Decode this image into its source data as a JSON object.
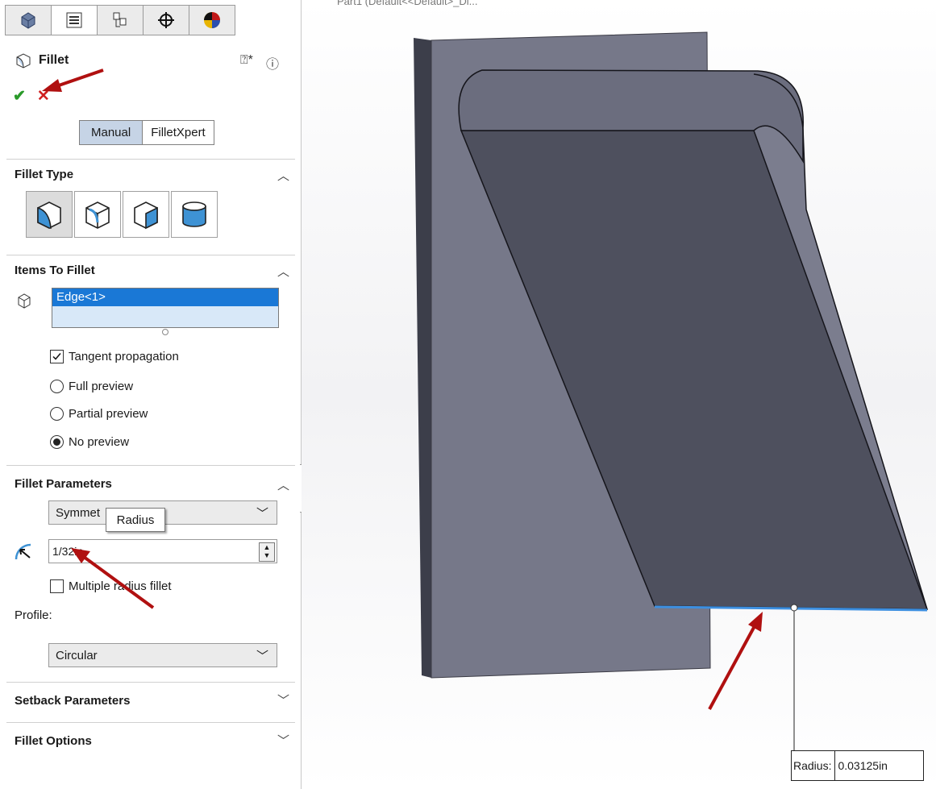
{
  "viewport": {
    "title": "Part1 (Default<<Default>_Di..."
  },
  "property_manager": {
    "tabs": [
      "feature-manager-icon",
      "property-manager-icon",
      "configuration-manager-icon",
      "dimxpert-manager-icon",
      "display-manager-icon"
    ],
    "active_tab": 1,
    "title": "Fillet",
    "mode_buttons": {
      "manual": "Manual",
      "filletxpert": "FilletXpert"
    },
    "fillet_type": {
      "heading": "Fillet Type",
      "options": [
        "constant-size-fillet-icon",
        "variable-size-fillet-icon",
        "face-fillet-icon",
        "full-round-fillet-icon"
      ],
      "selected": 0
    },
    "items_to_fillet": {
      "heading": "Items To Fillet",
      "selection": "Edge<1>",
      "tangent_propagation": {
        "label": "Tangent propagation",
        "checked": true
      },
      "preview_options": [
        "Full preview",
        "Partial preview",
        "No preview"
      ],
      "preview_selected": "No preview"
    },
    "fillet_parameters": {
      "heading": "Fillet Parameters",
      "method": "Symmet",
      "tooltip": "Radius",
      "radius": "1/32in",
      "multiple_radius": {
        "label": "Multiple radius fillet",
        "checked": false
      },
      "profile_label": "Profile:",
      "profile": "Circular"
    },
    "setback_parameters": {
      "heading": "Setback Parameters"
    },
    "fillet_options": {
      "heading": "Fillet Options"
    }
  },
  "radius_callout": {
    "label": "Radius:",
    "value": "0.03125in"
  },
  "colors": {
    "selection_blue": "#1a78d6",
    "accent_red": "#b01010",
    "model_face": "#7a7c8c",
    "model_dark": "#505262",
    "edge_highlight": "#3d8fe0"
  }
}
